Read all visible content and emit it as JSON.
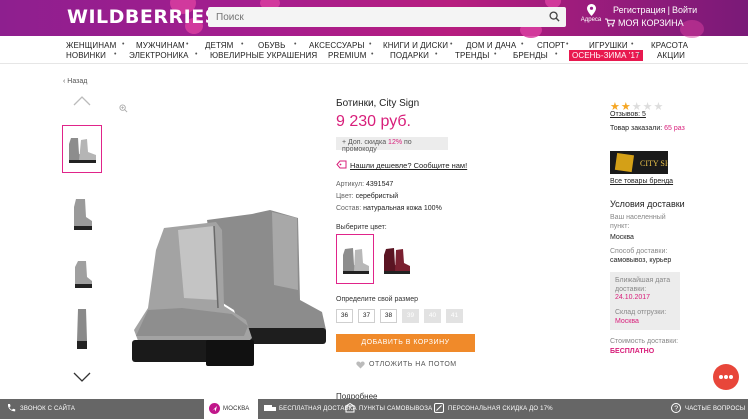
{
  "header": {
    "logo": "WILDBERRIES",
    "search_placeholder": "Поиск",
    "address_label": "Адреса",
    "register": "Регистрация",
    "login": "Войти",
    "cart": "МОЯ КОРЗИНА"
  },
  "nav": {
    "row1": [
      "ЖЕНЩИНАМ",
      "МУЖЧИНАМ",
      "ДЕТЯМ",
      "ОБУВЬ",
      "АКСЕССУАРЫ",
      "КНИГИ И ДИСКИ",
      "ДОМ И ДАЧА",
      "СПОРТ",
      "ИГРУШКИ",
      "КРАСОТА"
    ],
    "row2": [
      "НОВИНКИ",
      "ЭЛЕКТРОНИКА",
      "ЮВЕЛИРНЫЕ УКРАШЕНИЯ",
      "PREMIUM",
      "ПОДАРКИ",
      "ТРЕНДЫ",
      "БРЕНДЫ",
      "ОСЕНЬ-ЗИМА '17",
      "АКЦИИ"
    ]
  },
  "back_link": "Назад",
  "product": {
    "title": "Ботинки, City Sign",
    "price": "9 230 руб.",
    "promo_prefix": "+ Доп. скидка",
    "promo_percent": "12%",
    "promo_suffix": "по промокоду",
    "cheaper_link": "Нашли дешевле? Сообщите нам!",
    "article_label": "Артикул:",
    "article_value": "4391547",
    "color_label": "Цвет:",
    "color_value": "серебристый",
    "material_label": "Состав:",
    "material_value": "натуральная кожа 100%",
    "choose_color": "Выберите цвет:",
    "choose_size": "Определите свой размер",
    "sizes": [
      {
        "label": "36",
        "available": true
      },
      {
        "label": "37",
        "available": true
      },
      {
        "label": "38",
        "available": true
      },
      {
        "label": "39",
        "available": false
      },
      {
        "label": "40",
        "available": false
      },
      {
        "label": "41",
        "available": false
      }
    ],
    "add_to_cart": "ДОБАВИТЬ В КОРЗИНУ",
    "defer": "ОТЛОЖИТЬ НА ПОТОМ",
    "more_label": "Подробнее"
  },
  "side": {
    "rating": 2,
    "rating_max": 5,
    "reviews": "Отзывов: 5",
    "ordered_label": "Товар заказали:",
    "ordered_value": "65 раз",
    "brand_logo_text": "CITY SIGN",
    "brand_all": "Все товары бренда",
    "delivery_title": "Условия доставки",
    "region_label_1": "Ваш населенный",
    "region_label_2": "пункт:",
    "region_value": "Москва",
    "method_label": "Способ доставки:",
    "method_value": "самовывоз, курьер",
    "date_label_1": "Ближайшая дата",
    "date_label_2": "доставки:",
    "date_value": "24.10.2017",
    "warehouse_label": "Склад отгрузки:",
    "warehouse_value": "Москва",
    "cost_label": "Стоимость доставки:",
    "cost_value": "БЕСПЛАТНО"
  },
  "footer": {
    "callback": "ЗВОНОК С САЙТА",
    "city": "МОСКВА",
    "free_delivery": "БЕСПЛАТНАЯ ДОСТАВКА",
    "pickup": "ПУНКТЫ САМОВЫВОЗА",
    "discount": "ПЕРСОНАЛЬНАЯ СКИДКА ДО 17%",
    "faq": "ЧАСТЫЕ ВОПРОСЫ"
  },
  "colors": {
    "brand": "#a51d8e",
    "accent_pink": "#d81e7a",
    "cart_button": "#f08a2a",
    "star": "#f5a623"
  }
}
